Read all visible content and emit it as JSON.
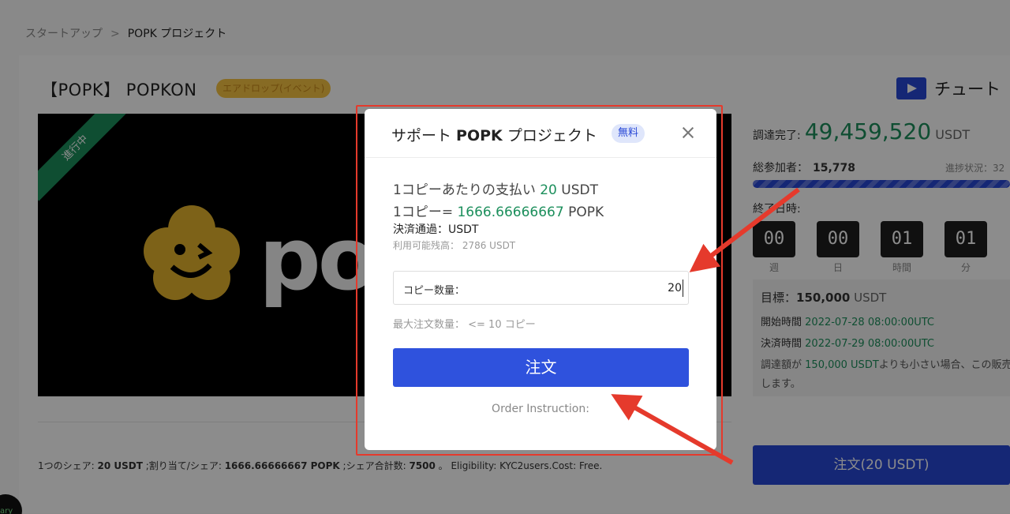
{
  "breadcrumb": {
    "parent": "スタートアップ",
    "separator": ">",
    "current": "POPK プロジェクト"
  },
  "project": {
    "title": "【POPK】 POPKON",
    "badge": "エアドロップ(イベント)",
    "banner_ribbon": "進行中",
    "logo_text": "po"
  },
  "tutorial": {
    "label": "チュート"
  },
  "stats": {
    "raised_label": "調達完了:",
    "raised_value": "49,459,520",
    "raised_unit": "USDT",
    "participants_label": "総参加者：",
    "participants_value": "15,778",
    "progress_label": "進捗状況：32",
    "end_label": "終了日時:",
    "countdown": [
      {
        "value": "00",
        "unit": "週"
      },
      {
        "value": "00",
        "unit": "日"
      },
      {
        "value": "01",
        "unit": "時間"
      },
      {
        "value": "01",
        "unit": "分"
      }
    ]
  },
  "info": {
    "goal_label": "目標：",
    "goal_value": "150,000",
    "goal_unit": " USDT",
    "start_label": "開始時間",
    "start_value": "2022-07-28 08:00:00UTC",
    "settle_label": "決済時間",
    "settle_value": "2022-07-29 08:00:00UTC",
    "note_prefix": "調達額が",
    "note_amount": "150,000 USDT",
    "note_suffix": "よりも小さい場合、この販売",
    "note_line2": "します。"
  },
  "share_line": {
    "p1": "1つのシェア: ",
    "v1": "20 USDT",
    "p2": " ;割り当て/シェア: ",
    "v2": "1666.66666667 POPK",
    "p3": " ;シェア合計数: ",
    "v3": "7500",
    "p4": " 。 Eligibility: KYC2users.Cost: Free."
  },
  "bottom_order_button": "注文(20 USDT)",
  "corner_badge": "ary",
  "modal": {
    "title_prefix": "サポート ",
    "title_token": "POPK",
    "title_suffix": " プロジェクト",
    "free_badge": "無料",
    "price_prefix": "1コピーあたりの支払い ",
    "price_value": "20",
    "price_unit": " USDT",
    "ratio_prefix": "1コピー= ",
    "ratio_value": "1666.66666667",
    "ratio_unit": " POPK",
    "payment_currency": "決済通過：USDT",
    "available_balance": "利用可能残高： 2786 USDT",
    "qty_label": "コピー数量：",
    "qty_value": "20",
    "max_order": "最大注文数量： <= 10 コピー",
    "order_button": "注文",
    "order_instruction": "Order Instruction:"
  },
  "colors": {
    "accent_blue": "#2747d6",
    "green": "#1c8f5c",
    "highlight_red": "#e53a2c",
    "badge_yellow": "#f6c343"
  }
}
